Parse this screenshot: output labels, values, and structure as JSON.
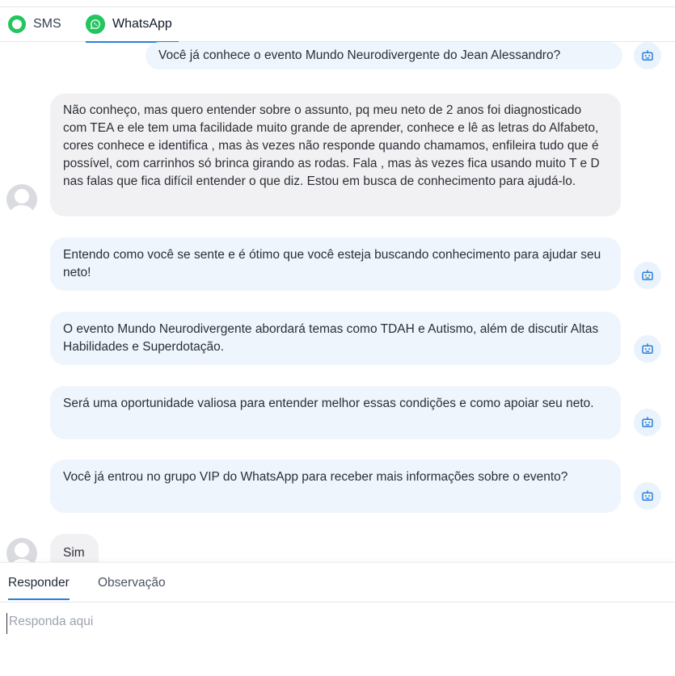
{
  "channels": {
    "sms_label": "SMS",
    "whatsapp_label": "WhatsApp",
    "active": "WhatsApp"
  },
  "colors": {
    "accent": "#2b7fd9",
    "whatsapp_green": "#22c55e",
    "bot_bubble": "#eef5fc",
    "user_bubble": "#f1f1f3"
  },
  "messages": [
    {
      "sender": "bot",
      "text": "Você já conhece o evento Mundo Neurodivergente do Jean Alessandro?",
      "icon": "bot-icon"
    },
    {
      "sender": "user",
      "text": "Não conheço, mas quero entender sobre o assunto, pq meu neto de 2 anos foi diagnosticado com TEA e ele tem uma facilidade muito grande de aprender, conhece e lê as letras do Alfabeto, cores conhece e identifica , mas às vezes não responde quando chamamos, enfileira tudo que é possível, com carrinhos só brinca girando as rodas. Fala , mas às vezes fica usando muito T e D nas falas que fica difícil entender o que diz. Estou em busca de conhecimento para ajudá-lo.",
      "icon": "user-avatar-icon"
    },
    {
      "sender": "bot",
      "text": "Entendo como você se sente e é ótimo que você esteja buscando conhecimento para ajudar seu neto!",
      "icon": "bot-icon"
    },
    {
      "sender": "bot",
      "text": "O evento Mundo Neurodivergente abordará temas como TDAH e Autismo, além de discutir Altas Habilidades e Superdotação.",
      "icon": "bot-icon"
    },
    {
      "sender": "bot",
      "text": "Será uma oportunidade valiosa para entender melhor essas condições e como apoiar seu neto.",
      "icon": "bot-icon"
    },
    {
      "sender": "bot",
      "text": "Você já entrou no grupo VIP do WhatsApp para receber mais informações sobre o evento?",
      "icon": "bot-icon"
    },
    {
      "sender": "user",
      "text": "Sim",
      "icon": "user-avatar-icon"
    }
  ],
  "composer": {
    "tab_reply": "Responder",
    "tab_note": "Observação",
    "active_tab": "Responder",
    "placeholder": "Responda aqui",
    "value": ""
  }
}
